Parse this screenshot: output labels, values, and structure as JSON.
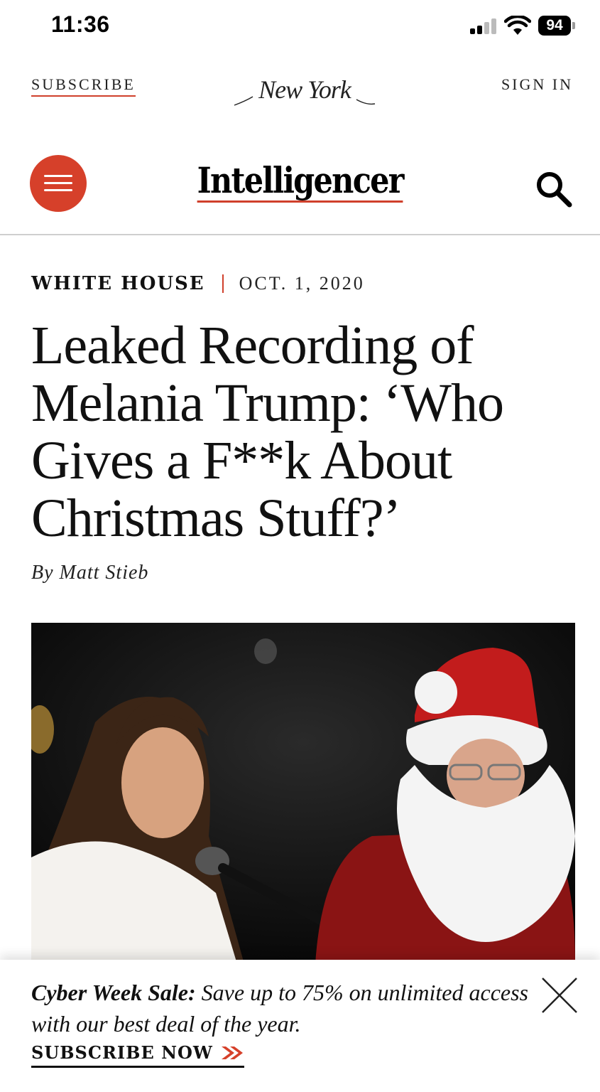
{
  "status_bar": {
    "time": "11:36",
    "battery": "94"
  },
  "top_nav": {
    "subscribe_label": "SUBSCRIBE",
    "logo_text": "NEW YORK",
    "signin_label": "SIGN IN"
  },
  "header": {
    "section_logo": "Intelligencer",
    "menu_icon": "hamburger-menu-icon",
    "search_icon": "search-icon"
  },
  "article": {
    "rubric": "WHITE HOUSE",
    "date": "OCT. 1, 2020",
    "headline": "Leaked Recording of Melania Trump: ‘Who Gives a F**k About Christmas Stuff?’",
    "byline_prefix": "By",
    "author": "Matt Stieb"
  },
  "promo": {
    "lead": "Cyber Week Sale:",
    "body": " Save up to 75% on unlimited access with our best deal of the year.",
    "cta_label": "SUBSCRIBE NOW",
    "close_icon": "close-icon"
  },
  "colors": {
    "accent": "#d6402a",
    "text": "#111111"
  }
}
